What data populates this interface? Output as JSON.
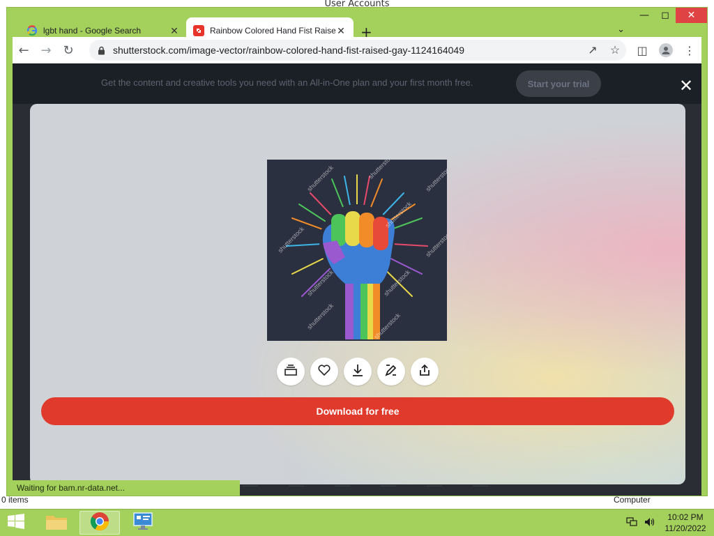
{
  "background_window": {
    "title": "User Accounts",
    "items_count": "0 items",
    "computer_label": "Computer"
  },
  "tabs": [
    {
      "label": "lgbt hand - Google Search",
      "favicon": "google-icon",
      "active": false
    },
    {
      "label": "Rainbow Colored Hand Fist Raised",
      "favicon": "shutterstock-icon",
      "active": true
    }
  ],
  "address_bar": {
    "url": "shutterstock.com/image-vector/rainbow-colored-hand-fist-raised-gay-1124164049"
  },
  "promo": {
    "text": "Get the content and creative tools you need with an All-in-One plan and your first month free.",
    "button": "Start your trial"
  },
  "modal": {
    "watermark": "shutterstock",
    "actions": [
      "collection-icon",
      "heart-icon",
      "download-icon",
      "edit-icon",
      "share-icon"
    ],
    "download_button": "Download for free"
  },
  "status_bar": {
    "text": "Waiting for bam.nr-data.net..."
  },
  "taskbar": {
    "time": "10:02 PM",
    "date": "11/20/2022"
  },
  "colors": {
    "window_frame": "#a4d05c",
    "download_button": "#e03a2c",
    "page_bg": "#2a2d34"
  }
}
